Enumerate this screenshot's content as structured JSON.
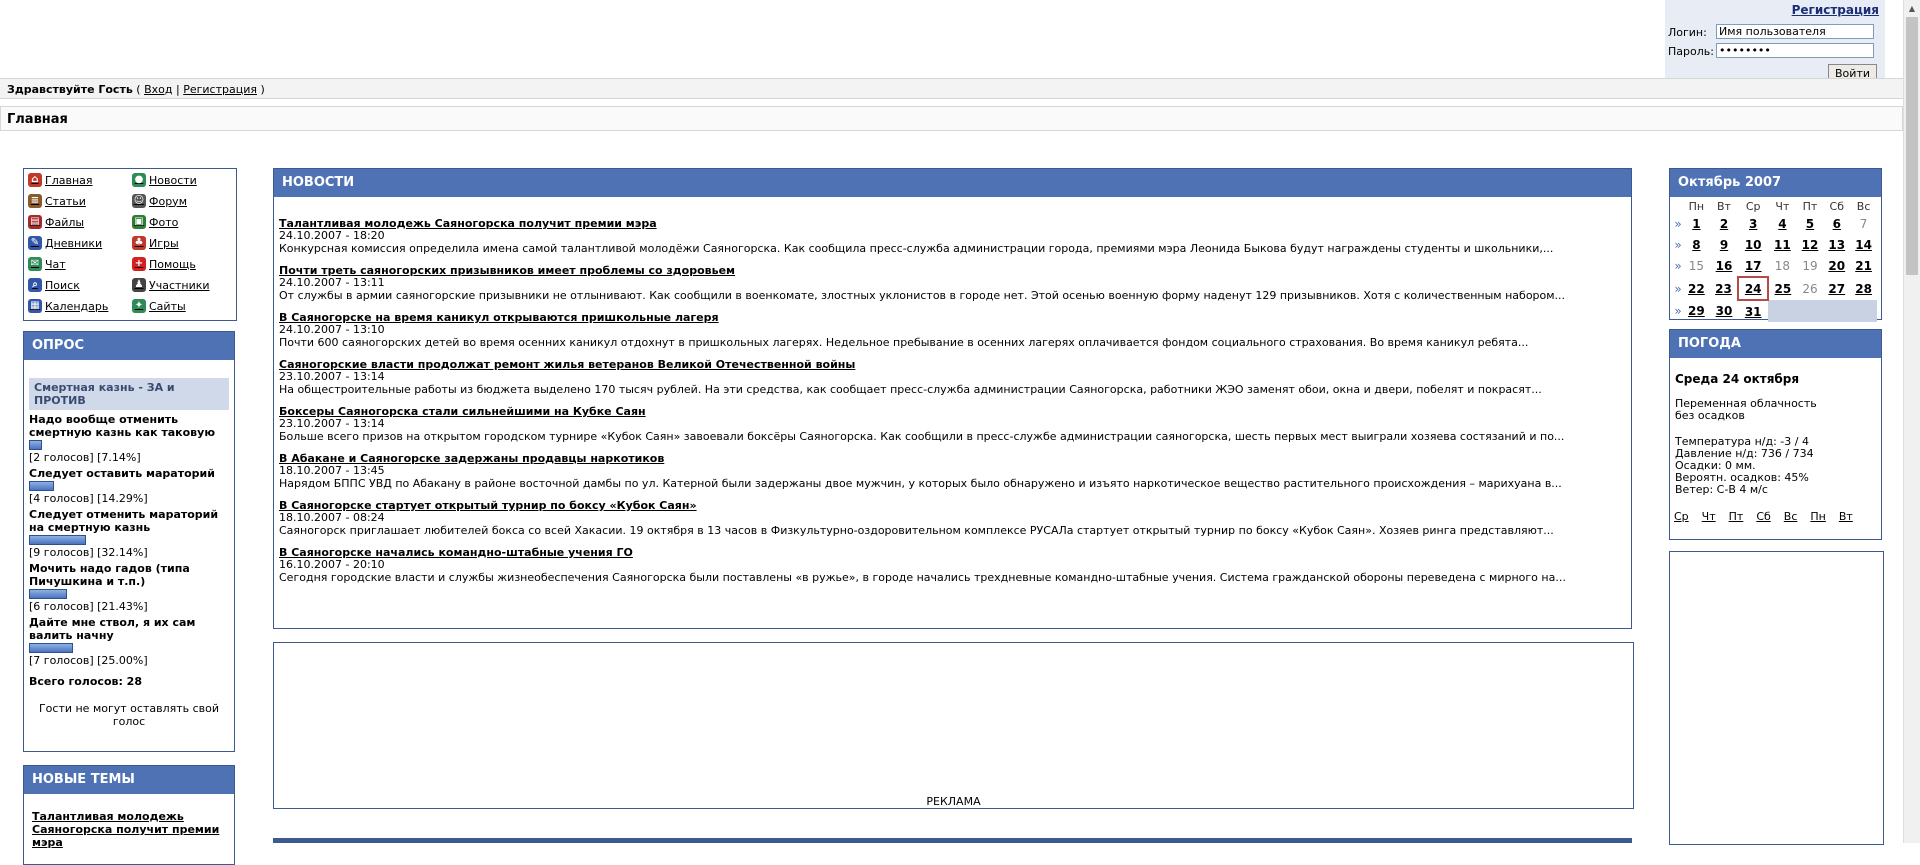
{
  "login": {
    "register_link": "Регистрация",
    "login_label": "Логин:",
    "login_value": "Имя пользователя",
    "password_label": "Пароль:",
    "password_value": "••••••••",
    "submit": "Войти"
  },
  "welcome": {
    "greeting": "Здравствуйте Гость",
    "open": "(",
    "login_link": "Вход",
    "sep": "|",
    "register_link": "Регистрация",
    "close": ")"
  },
  "breadcrumb": "Главная",
  "menu": [
    {
      "label": "Главная",
      "icon": "home-icon"
    },
    {
      "label": "Новости",
      "icon": "globe-icon"
    },
    {
      "label": "Статьи",
      "icon": "articles-icon"
    },
    {
      "label": "Форум",
      "icon": "forum-icon"
    },
    {
      "label": "Файлы",
      "icon": "files-icon"
    },
    {
      "label": "Фото",
      "icon": "photo-icon"
    },
    {
      "label": "Дневники",
      "icon": "diary-icon"
    },
    {
      "label": "Игры",
      "icon": "games-icon"
    },
    {
      "label": "Чат",
      "icon": "chat-icon"
    },
    {
      "label": "Помощь",
      "icon": "help-icon"
    },
    {
      "label": "Поиск",
      "icon": "search-icon"
    },
    {
      "label": "Участники",
      "icon": "users-icon"
    },
    {
      "label": "Календарь",
      "icon": "calendar-icon"
    },
    {
      "label": "Сайты",
      "icon": "sites-icon"
    }
  ],
  "poll": {
    "title": "ОПРОС",
    "question": "Смертная казнь - ЗА и ПРОТИВ",
    "options": [
      {
        "text": "Надо вообще отменить смертную казнь как таковую",
        "count": "2",
        "votes_word": "голосов",
        "percent": "7.14%",
        "share": 0.0714
      },
      {
        "text": "Следует оставить мараторий",
        "count": "4",
        "votes_word": "голосов",
        "percent": "14.29%",
        "share": 0.1429
      },
      {
        "text": "Следует отменить мараторий на смертную казнь",
        "count": "9",
        "votes_word": "голосов",
        "percent": "32.14%",
        "share": 0.3214
      },
      {
        "text": "Мочить надо гадов (типа Пичушкина и т.п.)",
        "count": "6",
        "votes_word": "голосов",
        "percent": "21.43%",
        "share": 0.2143
      },
      {
        "text": "Дайте мне ствол, я их сам валить начну",
        "count": "7",
        "votes_word": "голосов",
        "percent": "25.00%",
        "share": 0.25
      }
    ],
    "total": "Всего голосов: 28",
    "guest_note": "Гости не могут оставлять свой голос"
  },
  "topics": {
    "title": "НОВЫЕ ТЕМЫ",
    "items": [
      "Талантливая молодежь Саяногорска получит премии мэра"
    ]
  },
  "news": {
    "title": "НОВОСТИ",
    "items": [
      {
        "title": "Талантливая молодежь Саяногорска получит премии мэра",
        "date": "24.10.2007 - 18:20",
        "text": "Конкурсная комиссия определила имена самой талантливой молодёжи Саяногорска. Как сообщила пресс-служба администрации города, премиями мэра Леонида Быкова будут награждены студенты и школьники,..."
      },
      {
        "title": "Почти треть саяногорских призывников имеет проблемы со здоровьем",
        "date": "24.10.2007 - 13:11",
        "text": "От службы в армии саяногорские призывники не отлынивают. Как сообщили в военкомате, злостных уклонистов в городе нет. Этой осенью военную форму наденут 129 призывников. Хотя с количественным набором..."
      },
      {
        "title": "В Саяногорске на время каникул открываются пришкольные лагеря",
        "date": "24.10.2007 - 13:10",
        "text": "Почти 600 саяногорских детей во время осенних каникул отдохнут в пришкольных лагерях. Недельное пребывание в осенних лагерях оплачивается фондом социального страхования. Во время каникул ребята..."
      },
      {
        "title": "Саяногорские власти продолжат ремонт жилья ветеранов Великой Отечественной войны",
        "date": "23.10.2007 - 13:14",
        "text": "На общестроительные работы из бюджета выделено 170 тысяч рублей. На эти средства, как сообщает пресс-служба администрации Саяногорска, работники ЖЭО заменят обои, окна и двери, побелят и покрасят..."
      },
      {
        "title": "Боксеры Саяногорска стали сильнейшими на Кубке Саян",
        "date": "23.10.2007 - 13:14",
        "text": "Больше всего призов на открытом городском турнире «Кубок Саян» завоевали боксёры Саяногорска. Как сообщили в пресс-службе администрации саяногорска, шесть первых мест выиграли хозяева состязаний и по..."
      },
      {
        "title": "В Абакане и Саяногорске задержаны продавцы наркотиков",
        "date": "18.10.2007 - 13:45",
        "text": "Нарядом БППС УВД по Абакану в районе восточной дамбы по ул. Катерной были задержаны двое мужчин, у которых было обнаружено и изъято наркотическое вещество растительного происхождения – марихуана в..."
      },
      {
        "title": "В Саяногорске стартует открытый турнир по боксу «Кубок Саян»",
        "date": "18.10.2007 - 08:24",
        "text": "Саяногорск приглашает любителей бокса со всей Хакасии. 19 октября в 13 часов в Физкультурно-оздоровительном комплексе РУСАЛа стартует открытый турнир по боксу «Кубок Саян». Хозяев ринга представляют..."
      },
      {
        "title": "В Саяногорске начались командно-штабные учения ГО",
        "date": "16.10.2007 - 20:10",
        "text": "Сегодня городские власти и службы жизнеобеспечения Саяногорска были поставлены «в ружье», в городе начались трехдневные командно-штабные учения. Система гражданской обороны переведена с мирного на..."
      }
    ]
  },
  "ad": {
    "label": "РЕКЛАМА"
  },
  "calendar": {
    "title": "Октябрь 2007",
    "days": [
      "Пн",
      "Вт",
      "Ср",
      "Чт",
      "Пт",
      "Сб",
      "Вс"
    ],
    "week_marker": "»",
    "weeks": [
      [
        "1",
        "2",
        "3",
        "4",
        "5",
        "6",
        "7"
      ],
      [
        "8",
        "9",
        "10",
        "11",
        "12",
        "13",
        "14"
      ],
      [
        "15",
        "16",
        "17",
        "18",
        "19",
        "20",
        "21"
      ],
      [
        "22",
        "23",
        "24",
        "25",
        "26",
        "27",
        "28"
      ],
      [
        "29",
        "30",
        "31",
        "",
        "",
        "",
        ""
      ]
    ],
    "linked": [
      "1",
      "2",
      "3",
      "4",
      "5",
      "6",
      "8",
      "9",
      "10",
      "11",
      "12",
      "13",
      "14",
      "16",
      "17",
      "20",
      "21",
      "22",
      "23",
      "24",
      "25",
      "27",
      "28",
      "29",
      "30",
      "31"
    ],
    "today": "24"
  },
  "weather": {
    "title": "ПОГОДА",
    "date": "Среда 24 октября",
    "cloud": [
      "Переменная облачность",
      "без осадков"
    ],
    "details": [
      "Температура н/д: -3  /  4",
      "Давление н/д: 736  /  734",
      "Осадки: 0 мм.",
      "Вероятн. осадков: 45%",
      "Ветер: С-В 4 м/с"
    ],
    "day_links": [
      "Ср",
      "Чт",
      "Пт",
      "Сб",
      "Вс",
      "Пн",
      "Вт"
    ]
  }
}
